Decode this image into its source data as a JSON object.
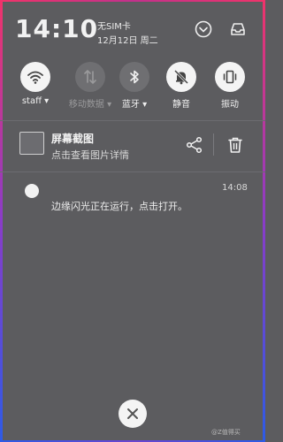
{
  "status": {
    "time": "14:10",
    "carrier": "无SIM卡",
    "date": "12月12日 周二",
    "expand_icon": "chevron-down-circle-icon",
    "tray_icon": "inbox-tray-icon"
  },
  "quick_toggles": [
    {
      "label": "staff",
      "icon": "wifi-icon",
      "active": true
    },
    {
      "label": "移动数据",
      "icon": "mobile-data-icon",
      "active": false
    },
    {
      "label": "蓝牙",
      "icon": "bluetooth-icon",
      "active": false
    },
    {
      "label": "静音",
      "icon": "mute-bell-icon",
      "active": true
    },
    {
      "label": "振动",
      "icon": "vibrate-icon",
      "active": true
    }
  ],
  "notifications": [
    {
      "title": "屏幕截图",
      "subtitle": "点击查看图片详情",
      "actions": [
        "share-icon",
        "delete-icon"
      ]
    },
    {
      "time": "14:08",
      "text": "边缘闪光正在运行，点击打开。"
    }
  ],
  "watermark": "@Z值得买",
  "colors": {
    "background": "#5c5c5f",
    "edge_top": "#f0336a",
    "edge_bottom": "#2d5be6",
    "toggle_on": "#f4f4f4",
    "toggle_off": "#6f6f72"
  }
}
